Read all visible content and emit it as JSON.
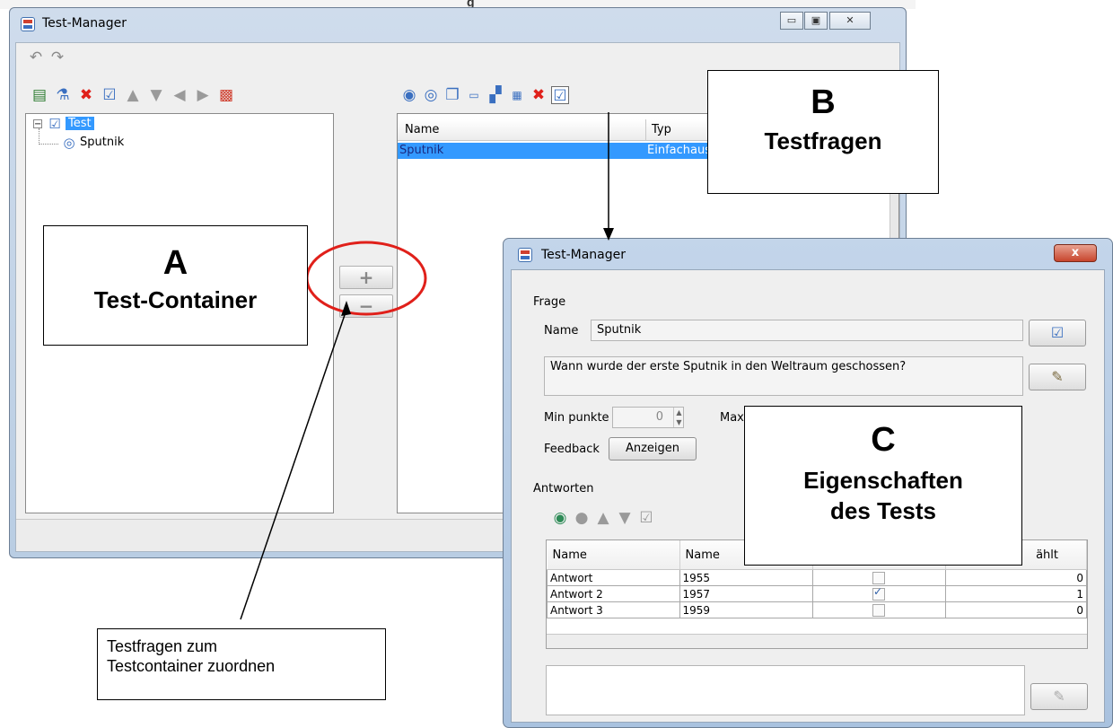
{
  "header_strip": "g",
  "main_window": {
    "title": "Test-Manager",
    "window_buttons": {
      "minimize": "▭",
      "maximize": "▣",
      "close": "✕"
    },
    "toolbar_top": [
      "undo-icon",
      "redo-icon"
    ],
    "left_toolbar": [
      "new-test-icon",
      "test-group-icon",
      "delete-icon",
      "edit-icon",
      "arrow-up-icon",
      "arrow-down-icon",
      "arrow-left-icon",
      "arrow-right-icon",
      "color-picture-icon"
    ],
    "right_toolbar": [
      "single-choice-icon",
      "multiple-choice-icon",
      "copy-icon",
      "text-field-icon",
      "image-hotspot-icon",
      "matching-icon",
      "delete-icon",
      "edit-icon"
    ],
    "tree": {
      "root": "Test",
      "child": "Sputnik"
    },
    "question_list": {
      "columns": [
        "Name",
        "Typ"
      ],
      "rows": [
        {
          "name": "Sputnik",
          "type": "Einfachaus"
        }
      ]
    },
    "assign_buttons": {
      "add": "+",
      "remove": "−"
    }
  },
  "dialog": {
    "title": "Test-Manager",
    "close_label": "x",
    "section_frage": "Frage",
    "name_label": "Name",
    "name_value": "Sputnik",
    "question_text": "Wann wurde der erste Sputnik in den Weltraum geschossen?",
    "min_points_label": "Min punkte",
    "min_points_value": "0",
    "max_points_label": "Max",
    "feedback_label": "Feedback",
    "feedback_button": "Anzeigen",
    "answers_section": "Antworten",
    "answers_toolbar": [
      "add-answer-icon",
      "remove-answer-icon",
      "arrow-up-icon",
      "arrow-down-icon",
      "edit-icon"
    ],
    "answers_columns": [
      "Name",
      "Name",
      "",
      "ählt"
    ],
    "answers_rows": [
      {
        "name": "Antwort",
        "value": "1955",
        "checked": false,
        "count": "0"
      },
      {
        "name": "Antwort 2",
        "value": "1957",
        "checked": true,
        "count": "1"
      },
      {
        "name": "Antwort 3",
        "value": "1959",
        "checked": false,
        "count": "0"
      }
    ]
  },
  "callouts": {
    "a_letter": "A",
    "a_text": "Test-Container",
    "b_letter": "B",
    "b_text": "Testfragen",
    "c_letter": "C",
    "c_text_line1": "Eigenschaften",
    "c_text_line2": "des Tests",
    "note_line1": "Testfragen zum",
    "note_line2": "Testcontainer zuordnen"
  },
  "colors": {
    "selection": "#3399ff",
    "highlight_ellipse": "#e0201a",
    "checkbox_check": "#2f5fa8"
  }
}
